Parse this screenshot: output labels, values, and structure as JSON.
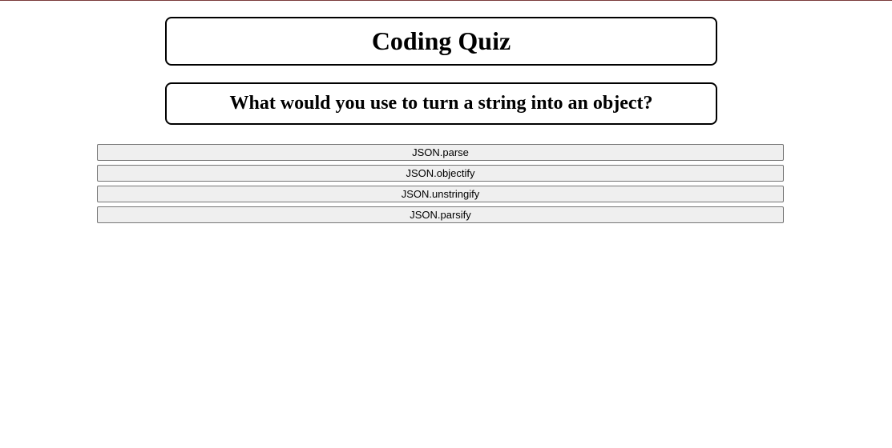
{
  "header": {
    "title": "Coding Quiz"
  },
  "quiz": {
    "question": "What would you use to turn a string into an object?",
    "answers": [
      {
        "label": "JSON.parse"
      },
      {
        "label": "JSON.objectify"
      },
      {
        "label": "JSON.unstringify"
      },
      {
        "label": "JSON.parsify"
      }
    ]
  }
}
